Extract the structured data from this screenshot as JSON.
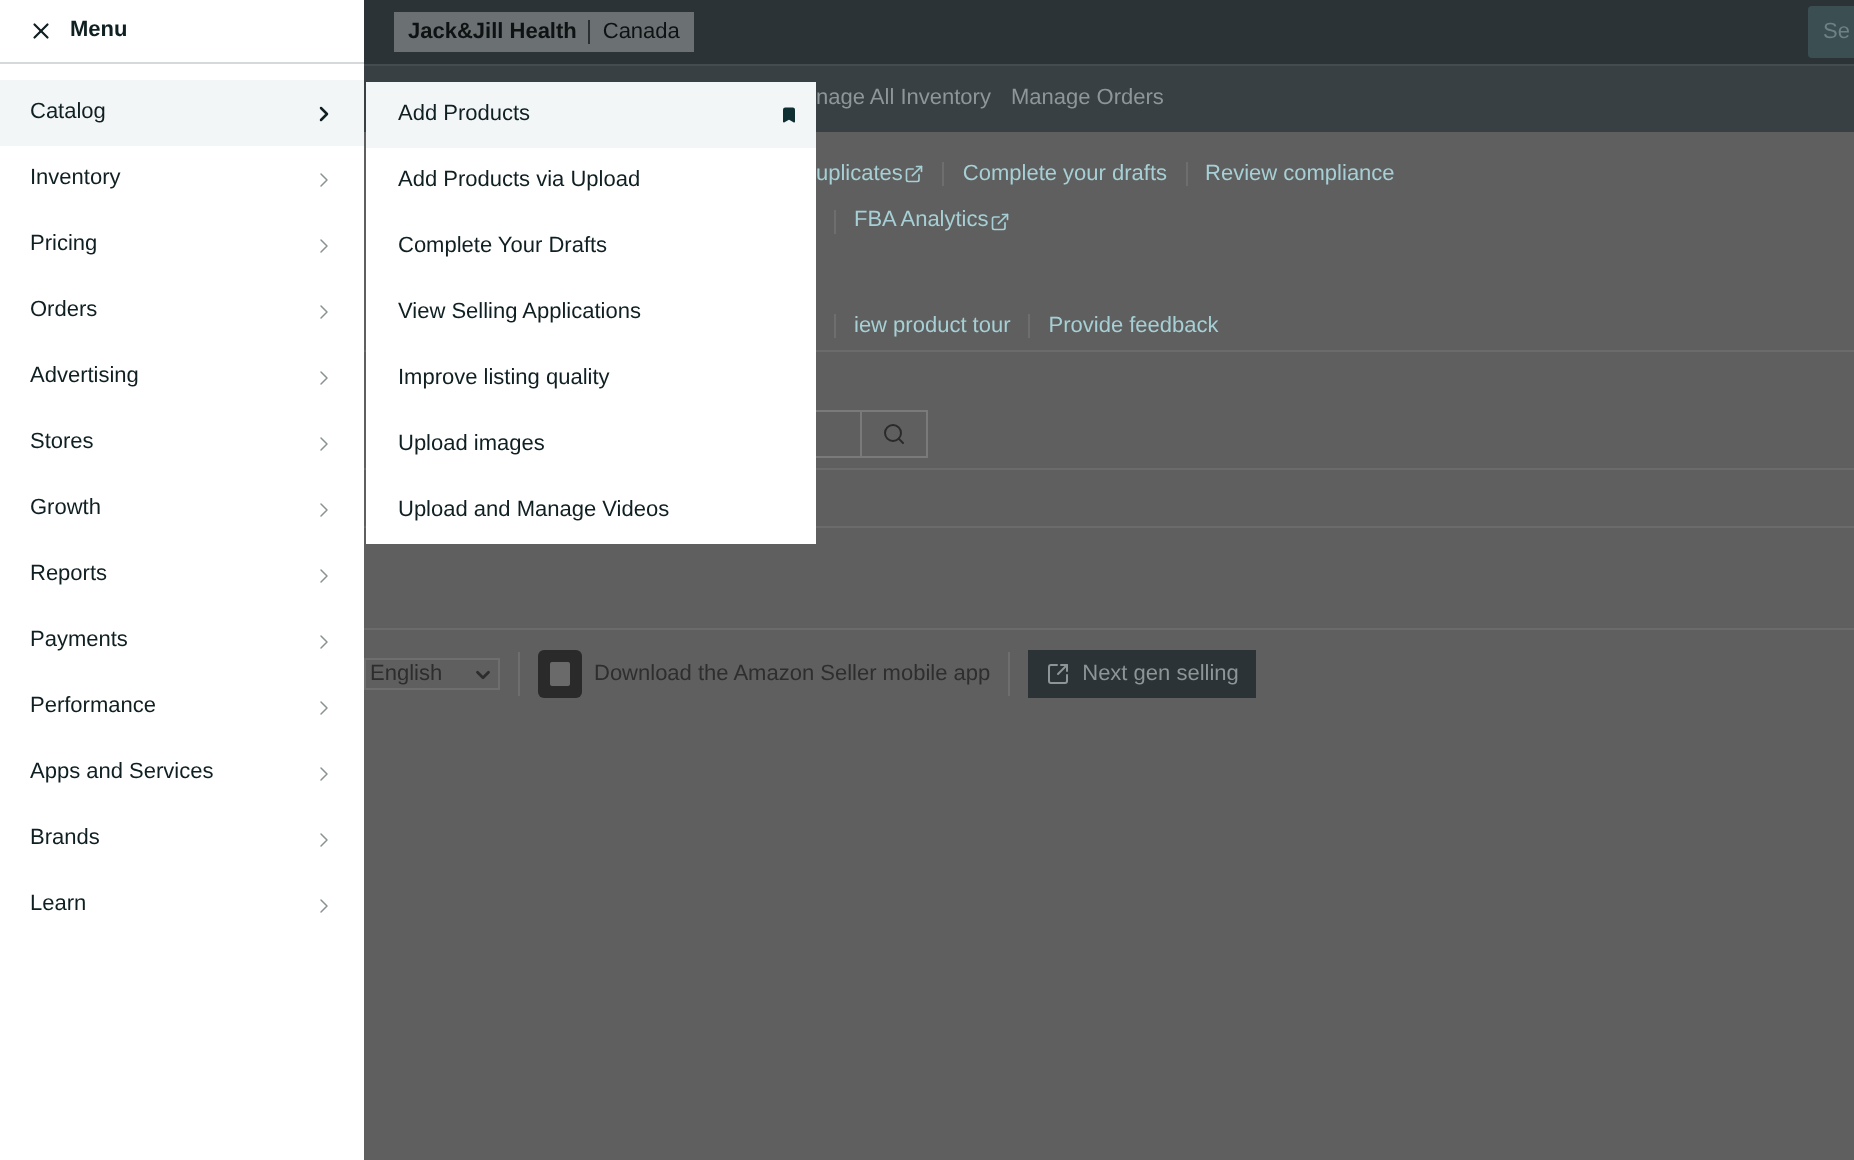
{
  "menu": {
    "title": "Menu",
    "items": [
      {
        "label": "Catalog",
        "selected": true
      },
      {
        "label": "Inventory",
        "selected": false
      },
      {
        "label": "Pricing",
        "selected": false
      },
      {
        "label": "Orders",
        "selected": false
      },
      {
        "label": "Advertising",
        "selected": false
      },
      {
        "label": "Stores",
        "selected": false
      },
      {
        "label": "Growth",
        "selected": false
      },
      {
        "label": "Reports",
        "selected": false
      },
      {
        "label": "Payments",
        "selected": false
      },
      {
        "label": "Performance",
        "selected": false
      },
      {
        "label": "Apps and Services",
        "selected": false
      },
      {
        "label": "Brands",
        "selected": false
      },
      {
        "label": "Learn",
        "selected": false
      }
    ]
  },
  "submenu": {
    "items": [
      {
        "label": "Add Products",
        "selected": true,
        "bookmarked": true
      },
      {
        "label": "Add Products via Upload",
        "selected": false,
        "bookmarked": false
      },
      {
        "label": "Complete Your Drafts",
        "selected": false,
        "bookmarked": false
      },
      {
        "label": "View Selling Applications",
        "selected": false,
        "bookmarked": false
      },
      {
        "label": "Improve listing quality",
        "selected": false,
        "bookmarked": false
      },
      {
        "label": "Upload images",
        "selected": false,
        "bookmarked": false
      },
      {
        "label": "Upload and Manage Videos",
        "selected": false,
        "bookmarked": false
      }
    ]
  },
  "page": {
    "account": {
      "name": "Jack&Jill Health",
      "region": "Canada"
    },
    "top_button": "Se",
    "nav": [
      "nage All Inventory",
      "Manage Orders"
    ],
    "links_row_1": [
      {
        "label": "uplicates",
        "external": true
      },
      {
        "label": "Complete your drafts",
        "external": false
      },
      {
        "label": "Review compliance",
        "external": false
      }
    ],
    "links_row_2": [
      {
        "label": "FBA Analytics",
        "external": true
      }
    ],
    "links_row_3": [
      {
        "label": "iew product tour",
        "external": false
      },
      {
        "label": "Provide feedback",
        "external": false
      }
    ],
    "footer": {
      "language": "English",
      "app_text": "Download the Amazon Seller mobile app",
      "button": "Next gen selling"
    }
  }
}
